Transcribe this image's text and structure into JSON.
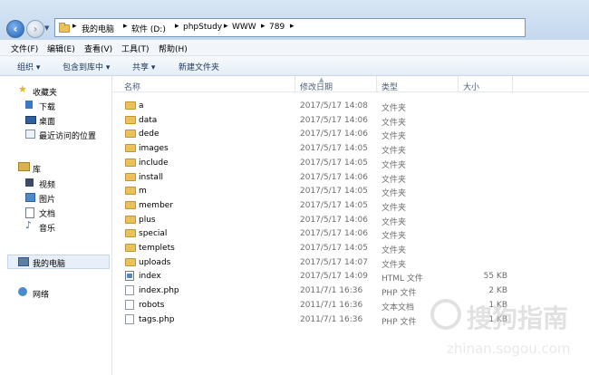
{
  "address": {
    "crumbs": [
      "我的电脑",
      "软件 (D:)",
      "phpStudy",
      "WWW",
      "789"
    ],
    "separator": "▸"
  },
  "menubar": [
    "文件(F)",
    "编辑(E)",
    "查看(V)",
    "工具(T)",
    "帮助(H)"
  ],
  "toolbar": {
    "organize": "组织 ▾",
    "include": "包含到库中 ▾",
    "share": "共享 ▾",
    "new_folder": "新建文件夹"
  },
  "nav": {
    "favorites": "收藏夹",
    "downloads": "下载",
    "desktop": "桌面",
    "recent": "最近访问的位置",
    "libraries": "库",
    "videos": "视频",
    "pictures": "图片",
    "documents": "文档",
    "music": "音乐",
    "computer": "我的电脑",
    "network": "网络"
  },
  "columns": {
    "name": "名称",
    "date": "修改日期",
    "type": "类型",
    "size": "大小"
  },
  "files": [
    {
      "name": "a",
      "date": "2017/5/17 14:08",
      "type": "文件夹",
      "size": "",
      "icon": "folder"
    },
    {
      "name": "data",
      "date": "2017/5/17 14:06",
      "type": "文件夹",
      "size": "",
      "icon": "folder"
    },
    {
      "name": "dede",
      "date": "2017/5/17 14:06",
      "type": "文件夹",
      "size": "",
      "icon": "folder"
    },
    {
      "name": "images",
      "date": "2017/5/17 14:05",
      "type": "文件夹",
      "size": "",
      "icon": "folder"
    },
    {
      "name": "include",
      "date": "2017/5/17 14:05",
      "type": "文件夹",
      "size": "",
      "icon": "folder"
    },
    {
      "name": "install",
      "date": "2017/5/17 14:06",
      "type": "文件夹",
      "size": "",
      "icon": "folder"
    },
    {
      "name": "m",
      "date": "2017/5/17 14:05",
      "type": "文件夹",
      "size": "",
      "icon": "folder"
    },
    {
      "name": "member",
      "date": "2017/5/17 14:05",
      "type": "文件夹",
      "size": "",
      "icon": "folder"
    },
    {
      "name": "plus",
      "date": "2017/5/17 14:06",
      "type": "文件夹",
      "size": "",
      "icon": "folder"
    },
    {
      "name": "special",
      "date": "2017/5/17 14:06",
      "type": "文件夹",
      "size": "",
      "icon": "folder"
    },
    {
      "name": "templets",
      "date": "2017/5/17 14:05",
      "type": "文件夹",
      "size": "",
      "icon": "folder"
    },
    {
      "name": "uploads",
      "date": "2017/5/17 14:07",
      "type": "文件夹",
      "size": "",
      "icon": "folder"
    },
    {
      "name": "index",
      "date": "2017/5/17 14:09",
      "type": "HTML 文件",
      "size": "55 KB",
      "icon": "html"
    },
    {
      "name": "index.php",
      "date": "2011/7/1 16:36",
      "type": "PHP 文件",
      "size": "2 KB",
      "icon": "doc"
    },
    {
      "name": "robots",
      "date": "2011/7/1 16:36",
      "type": "文本文档",
      "size": "1 KB",
      "icon": "doc"
    },
    {
      "name": "tags.php",
      "date": "2011/7/1 16:36",
      "type": "PHP 文件",
      "size": "1 KB",
      "icon": "doc"
    }
  ],
  "watermark": {
    "title": "搜狗指南",
    "url": "zhinan.sogou.com"
  }
}
